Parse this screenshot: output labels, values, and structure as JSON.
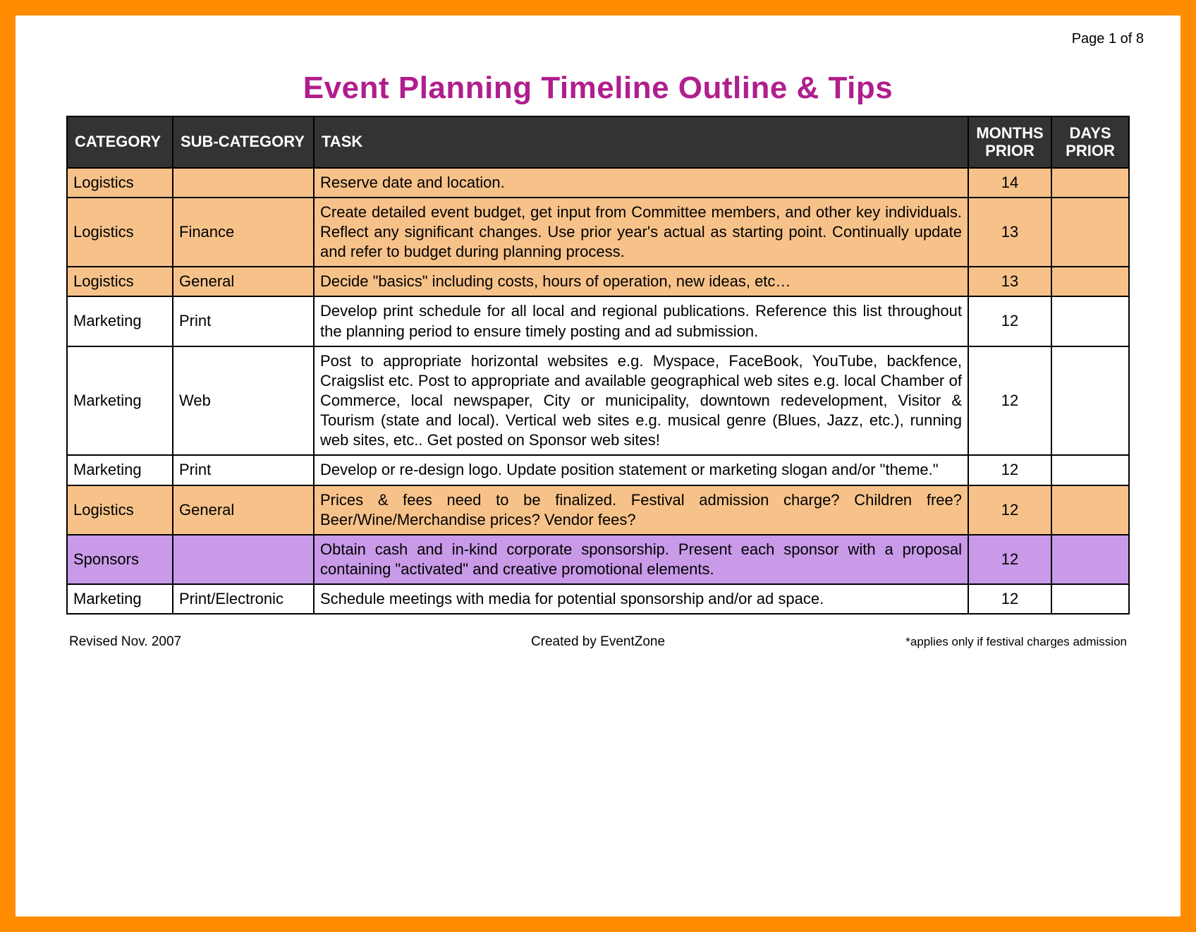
{
  "page_label": "Page 1 of 8",
  "title": "Event Planning Timeline Outline & Tips",
  "headers": {
    "category": "CATEGORY",
    "subcategory": "SUB-CATEGORY",
    "task": "TASK",
    "months_prior": "MONTHS PRIOR",
    "days_prior": "DAYS PRIOR"
  },
  "rows": [
    {
      "color": "orange",
      "category": "Logistics",
      "subcategory": "",
      "task": "Reserve date and location.",
      "months": "14",
      "days": ""
    },
    {
      "color": "orange",
      "category": "Logistics",
      "subcategory": "Finance",
      "task": "Create detailed event budget, get input from Committee members, and other key individuals.  Reflect any significant changes.  Use prior year's actual as starting point.  Continually update and refer to budget during planning process.",
      "months": "13",
      "days": ""
    },
    {
      "color": "orange",
      "category": "Logistics",
      "subcategory": "General",
      "task": "Decide \"basics\" including costs, hours of operation, new ideas, etc…",
      "months": "13",
      "days": ""
    },
    {
      "color": "white",
      "category": "Marketing",
      "subcategory": "Print",
      "task": "Develop print schedule for all local and regional publications.  Reference this list throughout the planning period to ensure timely posting and ad submission.",
      "months": "12",
      "days": ""
    },
    {
      "color": "white",
      "category": "Marketing",
      "subcategory": "Web",
      "task": "Post to appropriate horizontal websites e.g. Myspace, FaceBook, YouTube, backfence, Craigslist etc.  Post to appropriate and available geographical web sites e.g. local Chamber of Commerce, local newspaper, City or municipality, downtown redevelopment, Visitor & Tourism (state and local).  Vertical web sites e.g. musical genre (Blues, Jazz, etc.), running web sites, etc..  Get posted on Sponsor web sites!",
      "months": "12",
      "days": ""
    },
    {
      "color": "white",
      "category": "Marketing",
      "subcategory": "Print",
      "task": "Develop or re-design logo. Update position statement or marketing slogan and/or \"theme.\"",
      "months": "12",
      "days": ""
    },
    {
      "color": "orange",
      "category": "Logistics",
      "subcategory": "General",
      "task": "Prices & fees need to be finalized.  Festival admission charge?  Children free?   Beer/Wine/Merchandise prices? Vendor fees?",
      "months": "12",
      "days": ""
    },
    {
      "color": "purple",
      "category": "Sponsors",
      "subcategory": "",
      "task": "Obtain cash and in-kind corporate sponsorship.  Present each sponsor with a proposal containing \"activated\" and creative promotional elements.",
      "months": "12",
      "days": ""
    },
    {
      "color": "white",
      "category": "Marketing",
      "subcategory": "Print/Electronic",
      "task": "Schedule meetings with media for potential sponsorship and/or ad space.",
      "months": "12",
      "days": ""
    }
  ],
  "footer": {
    "left": "Revised Nov. 2007",
    "center": "Created by EventZone",
    "right": "*applies only if festival charges admission"
  }
}
